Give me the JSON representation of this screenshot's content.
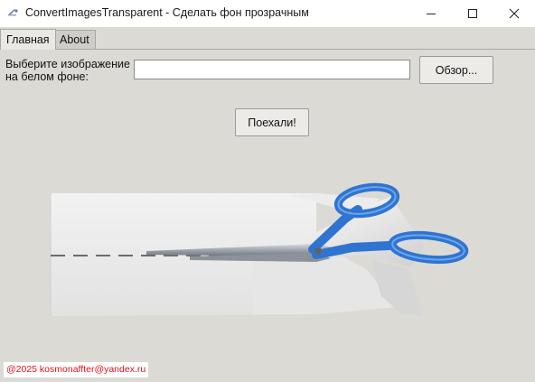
{
  "window": {
    "title": "ConvertImagesTransparent - Сделать фон прозрачным",
    "controls": {
      "minimize": "minimize-icon",
      "maximize": "maximize-icon",
      "close": "close-icon"
    }
  },
  "tabs": [
    {
      "label": "Главная",
      "active": true
    },
    {
      "label": "About",
      "active": false
    }
  ],
  "main": {
    "prompt_label": "Выберите изображение на белом фоне:",
    "path_input": {
      "value": "",
      "placeholder": ""
    },
    "browse_button": "Обзор...",
    "go_button": "Поехали!",
    "illustration": "scissors-cutting-paper-image"
  },
  "footer": {
    "text": "@2025 kosmonaffter@yandex.ru"
  },
  "colors": {
    "window_bg": "#dcdad4",
    "scissor_handle": "#2f74d0",
    "footer_text": "#e0101a"
  }
}
